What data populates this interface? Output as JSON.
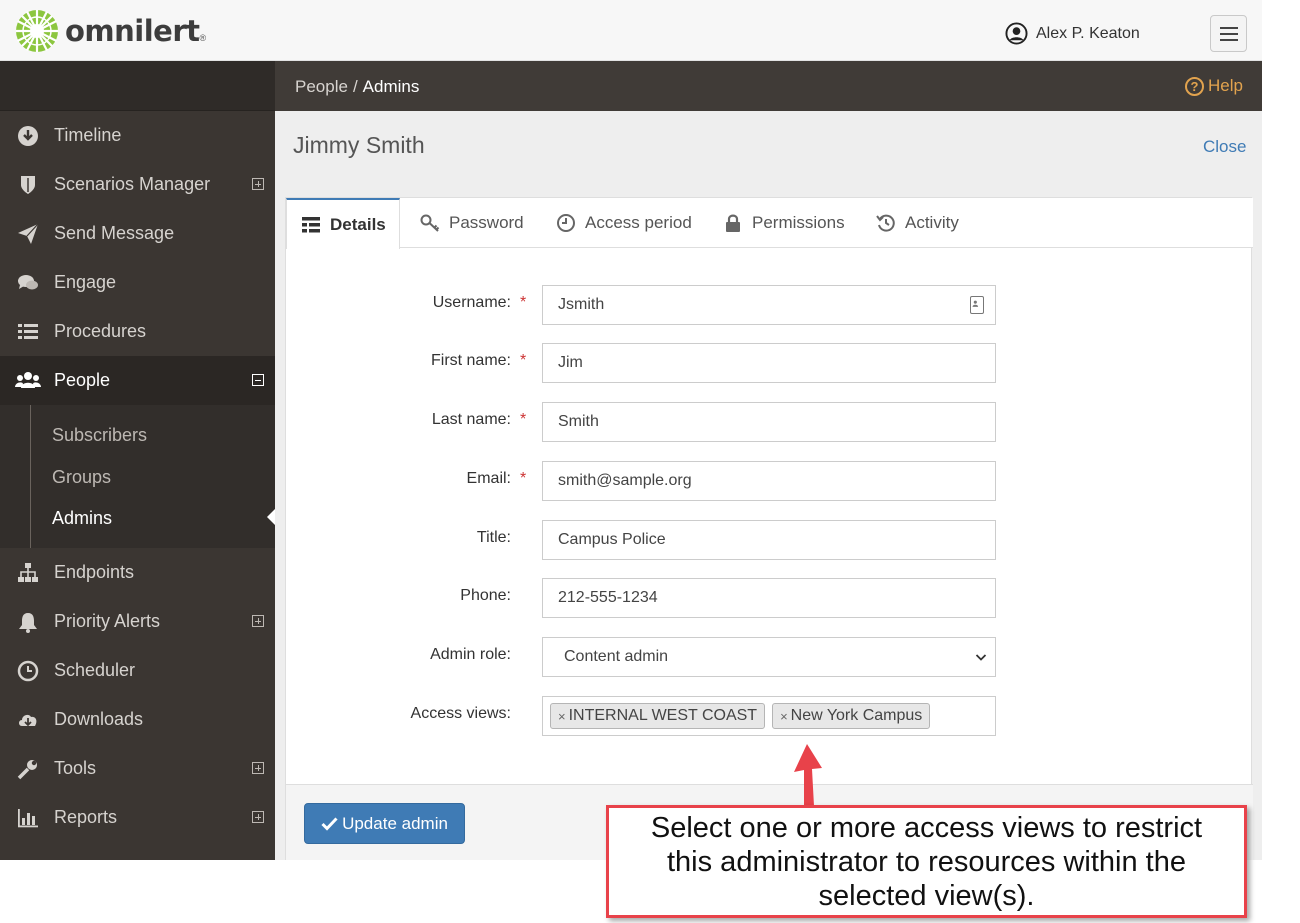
{
  "header": {
    "logo_text": "omnilert",
    "logo_mark": "®",
    "user_name": "Alex P. Keaton"
  },
  "sidebar": {
    "items": [
      {
        "label": "Timeline",
        "icon": "timeline-icon"
      },
      {
        "label": "Scenarios Manager",
        "icon": "shield-icon"
      },
      {
        "label": "Send Message",
        "icon": "paper-plane-icon"
      },
      {
        "label": "Engage",
        "icon": "chat-bubbles-icon"
      },
      {
        "label": "Procedures",
        "icon": "list-icon"
      },
      {
        "label": "People",
        "icon": "people-icon"
      },
      {
        "label": "Endpoints",
        "icon": "sitemap-icon"
      },
      {
        "label": "Priority Alerts",
        "icon": "bell-icon"
      },
      {
        "label": "Scheduler",
        "icon": "clock-icon"
      },
      {
        "label": "Downloads",
        "icon": "cloud-download-icon"
      },
      {
        "label": "Tools",
        "icon": "wrench-icon"
      },
      {
        "label": "Reports",
        "icon": "bar-chart-icon"
      }
    ],
    "people_subitems": [
      "Subscribers",
      "Groups",
      "Admins"
    ]
  },
  "breadcrumb": {
    "parent": "People",
    "separator": "/",
    "current": "Admins",
    "help": "Help"
  },
  "page": {
    "title": "Jimmy Smith",
    "close": "Close"
  },
  "tabs": [
    "Details",
    "Password",
    "Access period",
    "Permissions",
    "Activity"
  ],
  "form": {
    "username": {
      "label": "Username:",
      "value": "Jsmith",
      "required": "*"
    },
    "first_name": {
      "label": "First name:",
      "value": "Jim",
      "required": "*"
    },
    "last_name": {
      "label": "Last name:",
      "value": "Smith",
      "required": "*"
    },
    "email": {
      "label": "Email:",
      "value": "smith@sample.org",
      "required": "*"
    },
    "title": {
      "label": "Title:",
      "value": "Campus Police"
    },
    "phone": {
      "label": "Phone:",
      "value": "212-555-1234"
    },
    "admin_role": {
      "label": "Admin role:",
      "value": "Content admin"
    },
    "access_views": {
      "label": "Access views:",
      "tags": [
        "INTERNAL WEST COAST",
        "New York Campus"
      ],
      "remove_glyph": "×"
    }
  },
  "actions": {
    "update": "Update admin"
  },
  "annotation": {
    "text": "Select one or more access views to restrict this administrator to resources within the selected view(s)."
  },
  "colors": {
    "accent": "#3f7bb5",
    "sidebar": "#3b3632",
    "annotation_border": "#e8424a",
    "help": "#e2a34e",
    "logo_green": "#8cc63f"
  }
}
